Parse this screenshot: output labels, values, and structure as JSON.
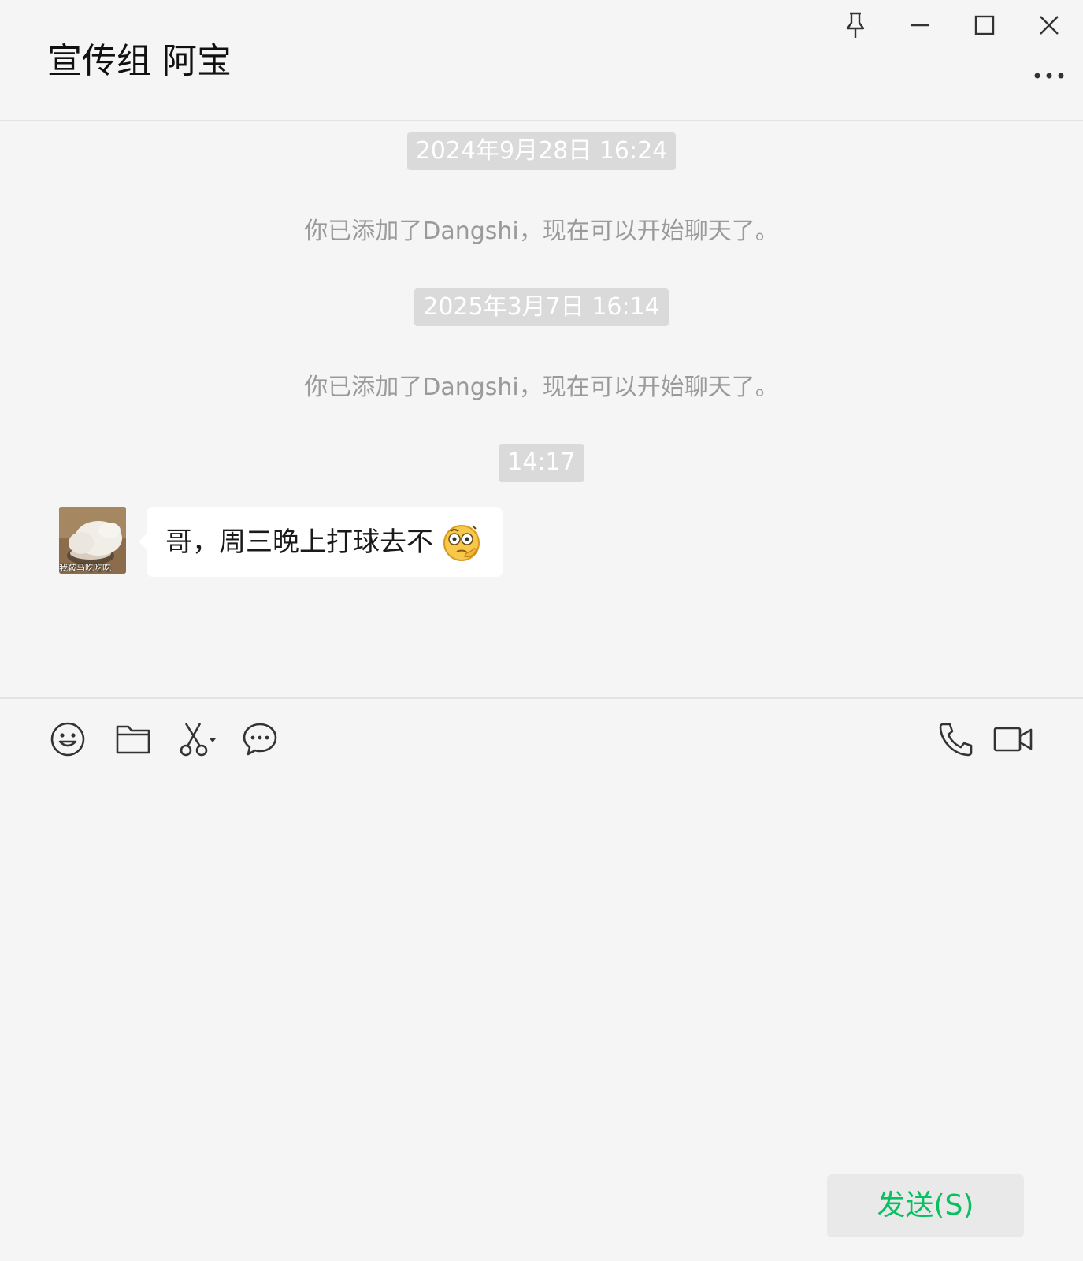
{
  "window": {
    "title": "宣传组 阿宝"
  },
  "messages": {
    "time_1": "2024年9月28日 16:24",
    "system_1": "你已添加了Dangshi，现在可以开始聊天了。",
    "time_2": "2025年3月7日 16:14",
    "system_2": "你已添加了Dangshi，现在可以开始聊天了。",
    "time_3": "14:17",
    "incoming": {
      "avatar_caption": "我鞍马吃吃吃",
      "text": "哥，周三晚上打球去不",
      "emoji": "thinking-face-emoji"
    }
  },
  "toolbar": {
    "icons": [
      "emoji-icon",
      "folder-icon",
      "scissors-icon",
      "chat-bubble-icon",
      "phone-icon",
      "video-icon"
    ]
  },
  "input": {
    "value": ""
  },
  "send": {
    "label": "发送(S)"
  },
  "colors": {
    "background": "#f5f5f5",
    "bubble": "#ffffff",
    "time_badge": "#dadada",
    "system_text": "#9a9a9a",
    "send_text": "#07c160",
    "send_bg": "#e9e9e9"
  }
}
